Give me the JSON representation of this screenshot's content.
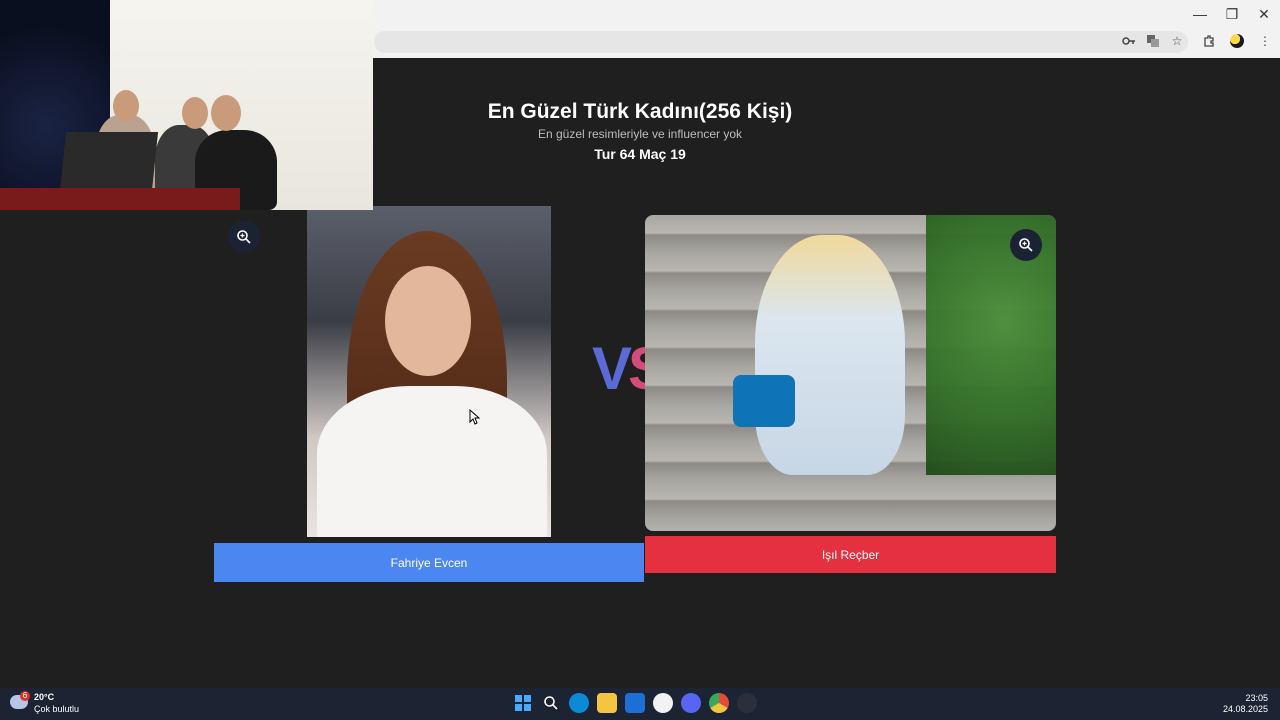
{
  "browser": {
    "window_controls": [
      "—",
      "❐",
      "✕"
    ],
    "address_icons": [
      "key-icon",
      "translate-icon",
      "bookmark-star-icon"
    ],
    "toolbar_icons": [
      "extensions-icon",
      "profile-avatar",
      "more-menu-icon"
    ]
  },
  "header": {
    "title": "En Güzel Türk Kadını(256 Kişi)",
    "subtitle": "En güzel resimleriyle ve influencer yok",
    "round_info": "Tur 64 Maç 19"
  },
  "contestants": {
    "left": {
      "name": "Fahriye Evcen",
      "button_color": "#4c86f0"
    },
    "right": {
      "name": "Işıl Reçber",
      "button_color": "#e5303f"
    }
  },
  "vs": {
    "v": "V",
    "s": "S"
  },
  "taskbar": {
    "weather": {
      "temp": "20°C",
      "desc": "Çok bulutlu",
      "badge": "6"
    },
    "apps": [
      "windows-start-icon",
      "search-icon",
      "edge-icon",
      "file-explorer-icon",
      "outlook-icon",
      "itunes-icon",
      "discord-icon",
      "chrome-icon",
      "clock-app-icon"
    ],
    "clock": {
      "time": "23:05",
      "date": "24.08.2025"
    }
  }
}
